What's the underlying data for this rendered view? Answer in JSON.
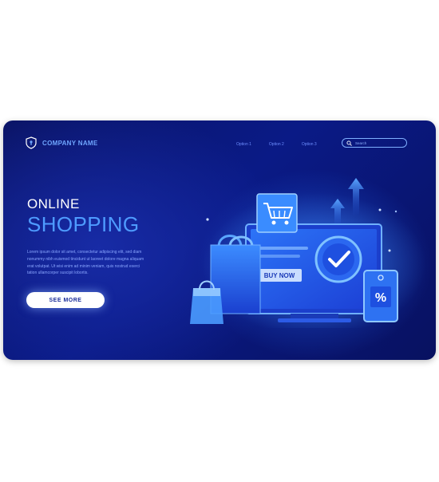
{
  "header": {
    "company_name": "COMPANY NAME",
    "logo_icon": "shield-lock-icon"
  },
  "nav": {
    "items": [
      {
        "label": "Option 1"
      },
      {
        "label": "Option 2"
      },
      {
        "label": "Option 3"
      }
    ]
  },
  "search": {
    "placeholder": "Search",
    "icon": "search-icon"
  },
  "hero": {
    "line1": "ONLINE",
    "line2": "SHOPPING",
    "body_lines": [
      "Lorem ipsum dolor sit amet, consectetur adipiscing elit, sed diam",
      "nonummy nibh euismod tincidunt ut laoreet dolore magna aliquam",
      "erat volutpat. Ut wisi enim ad minim veniam, quis nostrud exerci",
      "tation ullamcorper suscipit lobortis."
    ],
    "cta_label": "SEE MORE"
  },
  "illustration": {
    "buy_now_label": "BUY NOW",
    "discount_symbol": "%",
    "icons": [
      "cart-icon",
      "check-badge-icon",
      "shopping-bag-icon",
      "price-tag-icon",
      "arrow-up-icon",
      "monitor-icon"
    ]
  },
  "colors": {
    "background": "#0a1a86",
    "accent": "#4e9bff",
    "company_name": "#6fa6ff",
    "button_bg": "#ffffff",
    "button_text": "#1a2d9a"
  }
}
